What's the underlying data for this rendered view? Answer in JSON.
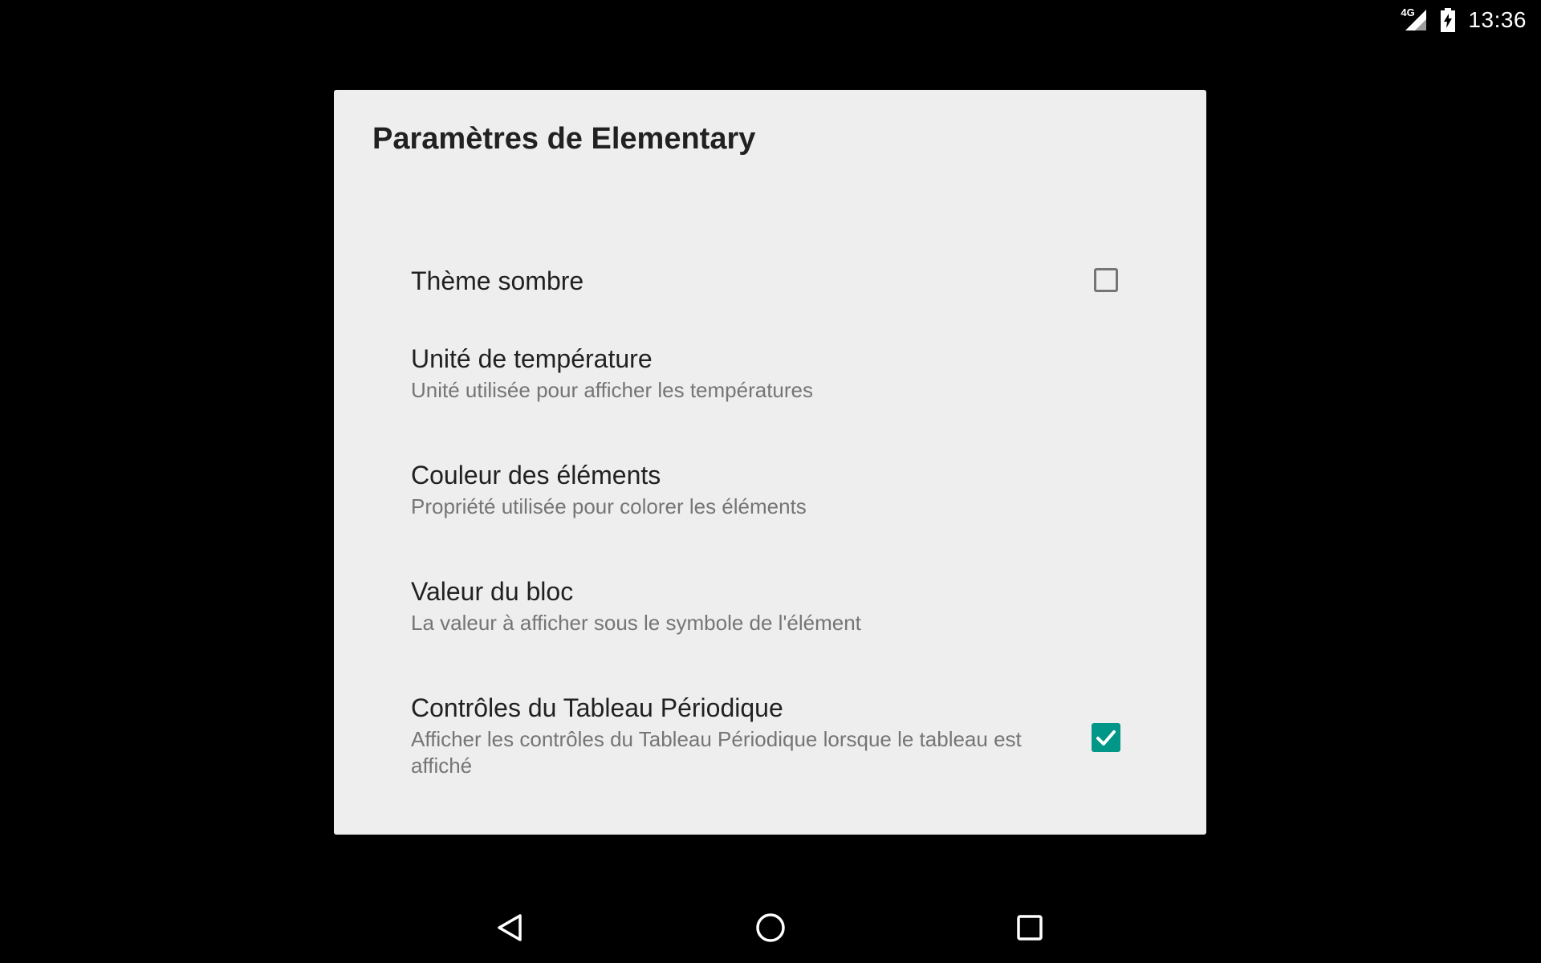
{
  "status_bar": {
    "network_type": "4G",
    "signal_icon": "cell-signal-icon",
    "battery_icon": "battery-charging-icon",
    "time": "13:36"
  },
  "dialog": {
    "title": "Paramètres de Elementary",
    "preferences": [
      {
        "title": "Thème sombre",
        "summary": "",
        "widget": "checkbox",
        "checked": false
      },
      {
        "title": "Unité de température",
        "summary": "Unité utilisée pour afficher les températures",
        "widget": "none"
      },
      {
        "title": "Couleur des éléments",
        "summary": "Propriété utilisée pour colorer les éléments",
        "widget": "none"
      },
      {
        "title": "Valeur du bloc",
        "summary": "La valeur à afficher sous le symbole de l'élément",
        "widget": "none"
      },
      {
        "title": "Contrôles du Tableau Périodique",
        "summary": "Afficher les contrôles du Tableau Périodique lorsque le tableau est affiché",
        "widget": "checkbox",
        "checked": true
      }
    ]
  },
  "nav_bar": {
    "back_icon": "back-triangle-icon",
    "home_icon": "home-circle-icon",
    "recents_icon": "recents-square-icon"
  },
  "colors": {
    "accent": "#009688",
    "dialog_background": "#eeeeee",
    "screen_background": "#000000",
    "title_text": "#212121",
    "summary_text": "#757575"
  }
}
